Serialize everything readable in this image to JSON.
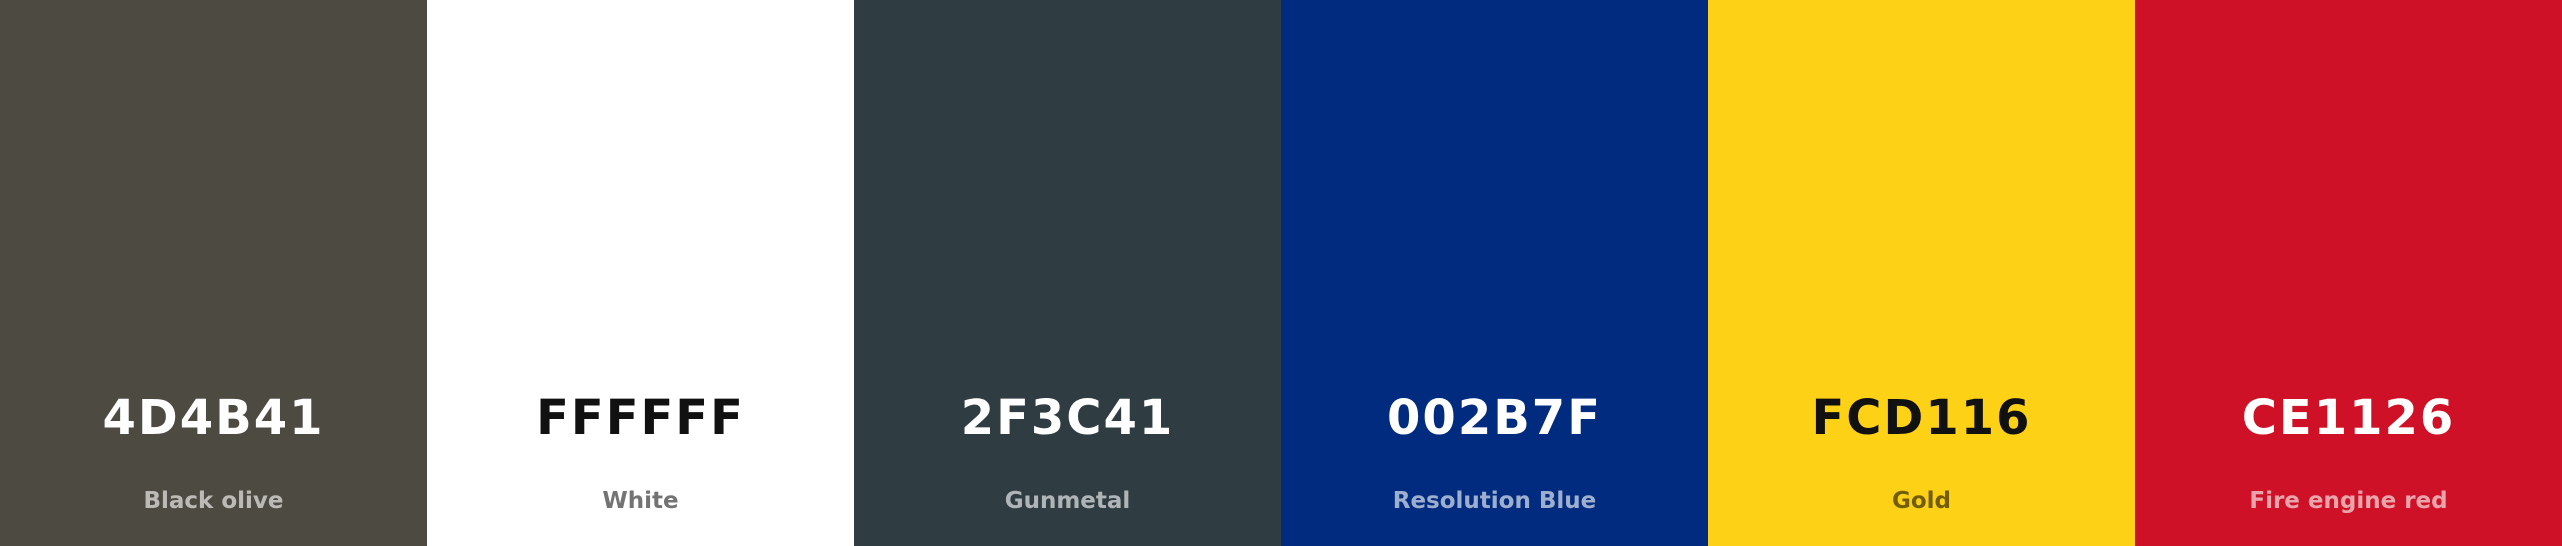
{
  "palette": {
    "colors": [
      {
        "hex": "4D4B41",
        "name": "Black olive",
        "color": "#4D4B41",
        "text_theme": "light"
      },
      {
        "hex": "FFFFFF",
        "name": "White",
        "color": "#FFFFFF",
        "text_theme": "dark"
      },
      {
        "hex": "2F3C41",
        "name": "Gunmetal",
        "color": "#2F3C41",
        "text_theme": "light"
      },
      {
        "hex": "002B7F",
        "name": "Resolution Blue",
        "color": "#002B7F",
        "text_theme": "light"
      },
      {
        "hex": "FCD116",
        "name": "Gold",
        "color": "#FCD116",
        "text_theme": "dark"
      },
      {
        "hex": "CE1126",
        "name": "Fire engine red",
        "color": "#CE1126",
        "text_theme": "light"
      }
    ]
  }
}
